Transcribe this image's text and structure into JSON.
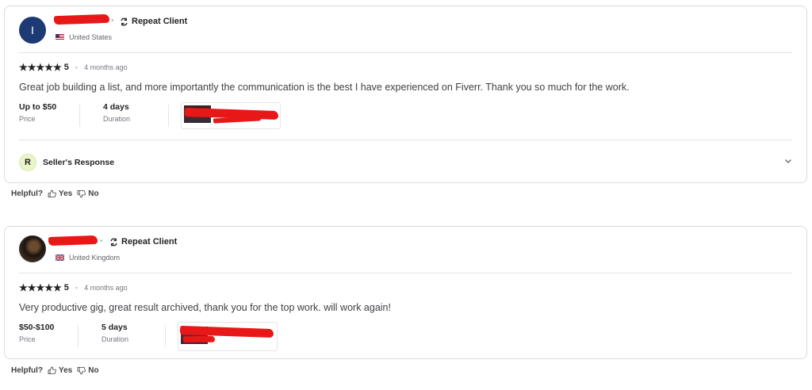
{
  "reviews": [
    {
      "avatar_letter": "I",
      "badge": "Repeat Client",
      "country": "United States",
      "stars": "★★★★★",
      "rating": "5",
      "time": "4 months ago",
      "text": "Great job building a list, and more importantly the communication is the best I have experienced on Fiverr. Thank you so much for the work.",
      "price_value": "Up to $50",
      "price_label": "Price",
      "duration_value": "4 days",
      "duration_label": "Duration",
      "seller_response_initial": "R",
      "seller_response_label": "Seller's Response"
    },
    {
      "badge": "Repeat Client",
      "country": "United Kingdom",
      "stars": "★★★★★",
      "rating": "5",
      "time": "4 months ago",
      "text": "Very productive gig, great result archived, thank you for the top work. will work again!",
      "price_value": "$50-$100",
      "price_label": "Price",
      "duration_value": "5 days",
      "duration_label": "Duration"
    }
  ],
  "helpful": {
    "label": "Helpful?",
    "yes": "Yes",
    "no": "No"
  },
  "colors": {
    "redaction": "#e81818",
    "avatar_bg": "#1e3a74",
    "border": "#dadbdd"
  }
}
